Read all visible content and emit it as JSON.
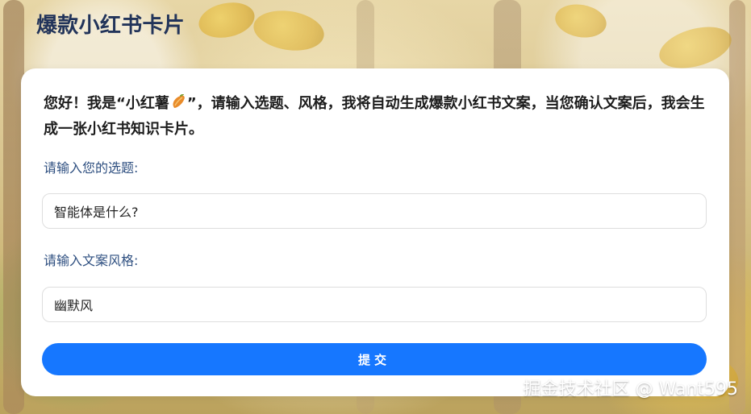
{
  "page": {
    "title": "爆款小红书卡片"
  },
  "card": {
    "intro_part1": "您好！我是“小红薯",
    "intro_icon": "sweet-potato-icon",
    "intro_part2": "”，请输入选题、风格，我将自动生成爆款小红书文案，当您确认文案后，我会生成一张小红书知识卡片。",
    "topic_label": "请输入您的选题:",
    "topic_value": "智能体是什么?",
    "style_label": "请输入文案风格:",
    "style_value": "幽默风",
    "submit_label": "提交"
  },
  "watermark": "掘金技术社区 @ Want595",
  "colors": {
    "accent": "#1677ff",
    "title": "#22345a",
    "label": "#2e4f80"
  }
}
